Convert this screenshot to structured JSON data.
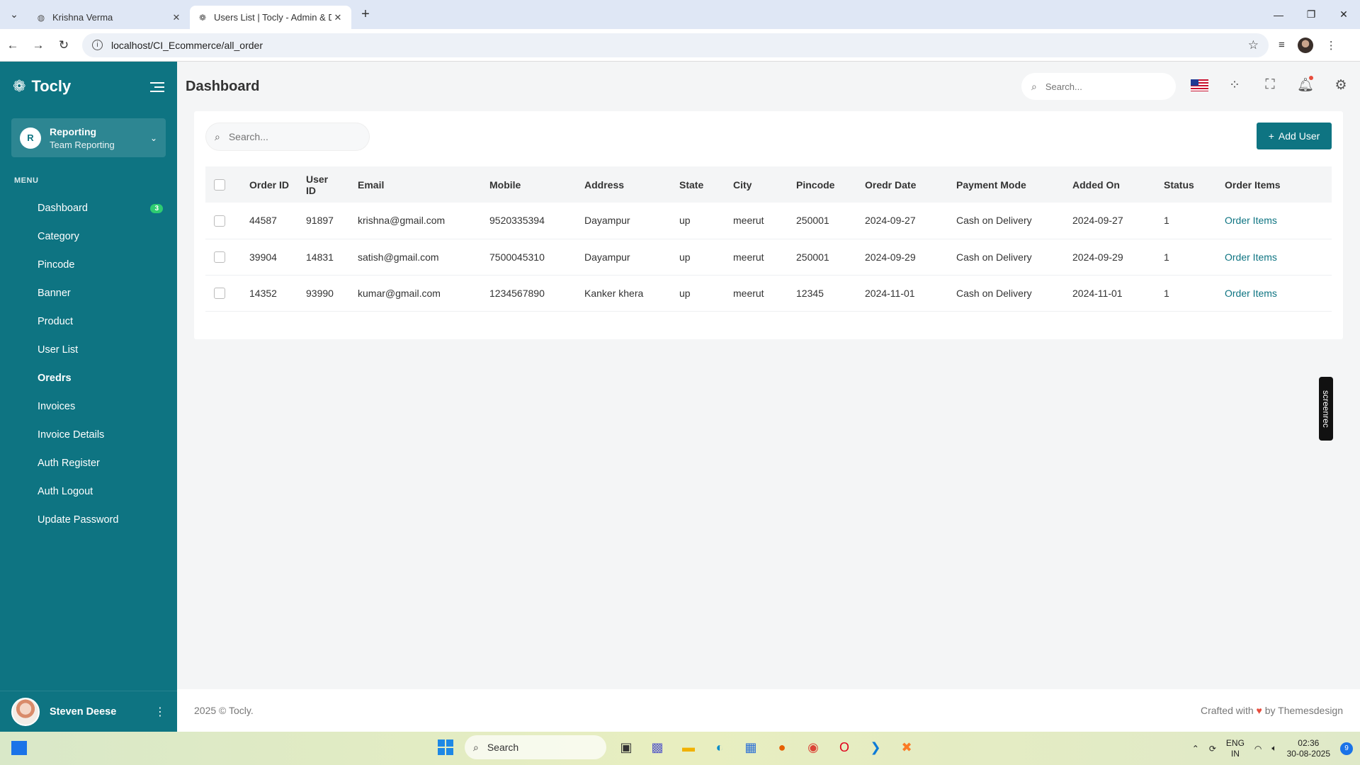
{
  "browser": {
    "tabs": [
      {
        "title": "Krishna Verma"
      },
      {
        "title": "Users List | Tocly - Admin & Da"
      }
    ],
    "url": "localhost/CI_Ecommerce/all_order"
  },
  "sidebar": {
    "brand": "Tocly",
    "team": {
      "initial": "R",
      "name": "Reporting",
      "subtitle": "Team Reporting"
    },
    "menu_title": "MENU",
    "items": [
      {
        "label": "Dashboard",
        "badge": "3"
      },
      {
        "label": "Category"
      },
      {
        "label": "Pincode"
      },
      {
        "label": "Banner"
      },
      {
        "label": "Product"
      },
      {
        "label": "User List"
      },
      {
        "label": "Oredrs"
      },
      {
        "label": "Invoices"
      },
      {
        "label": "Invoice Details"
      },
      {
        "label": "Auth Register"
      },
      {
        "label": "Auth Logout"
      },
      {
        "label": "Update Password"
      }
    ],
    "user": {
      "name": "Steven Deese"
    }
  },
  "header": {
    "title": "Dashboard",
    "search_placeholder": "Search..."
  },
  "main": {
    "search_placeholder": "Search...",
    "add_button": "Add User",
    "columns": [
      "Order ID",
      "User ID",
      "Email",
      "Mobile",
      "Address",
      "State",
      "City",
      "Pincode",
      "Oredr Date",
      "Payment Mode",
      "Added On",
      "Status",
      "Order Items"
    ],
    "rows": [
      {
        "order_id": "44587",
        "user_id": "91897",
        "email": "krishna@gmail.com",
        "mobile": "9520335394",
        "address": "Dayampur",
        "state": "up",
        "city": "meerut",
        "pincode": "250001",
        "order_date": "2024-09-27",
        "payment": "Cash on Delivery",
        "added_on": "2024-09-27",
        "status": "1",
        "items": "Order Items"
      },
      {
        "order_id": "39904",
        "user_id": "14831",
        "email": "satish@gmail.com",
        "mobile": "7500045310",
        "address": "Dayampur",
        "state": "up",
        "city": "meerut",
        "pincode": "250001",
        "order_date": "2024-09-29",
        "payment": "Cash on Delivery",
        "added_on": "2024-09-29",
        "status": "1",
        "items": "Order Items"
      },
      {
        "order_id": "14352",
        "user_id": "93990",
        "email": "kumar@gmail.com",
        "mobile": "1234567890",
        "address": "Kanker khera",
        "state": "up",
        "city": "meerut",
        "pincode": "12345",
        "order_date": "2024-11-01",
        "payment": "Cash on Delivery",
        "added_on": "2024-11-01",
        "status": "1",
        "items": "Order Items"
      }
    ]
  },
  "footer": {
    "left": "2025 © Tocly.",
    "right_prefix": "Crafted with",
    "right_suffix": "by Themesdesign"
  },
  "overlay": {
    "screenrec": "screenrec"
  },
  "taskbar": {
    "search": "Search",
    "lang_top": "ENG",
    "lang_bottom": "IN",
    "time": "02:36",
    "date": "30-08-2025",
    "badge": "9"
  },
  "colors": {
    "primary": "#0e7482",
    "badge": "#2ecc71",
    "accent_red": "#e74c3c"
  }
}
